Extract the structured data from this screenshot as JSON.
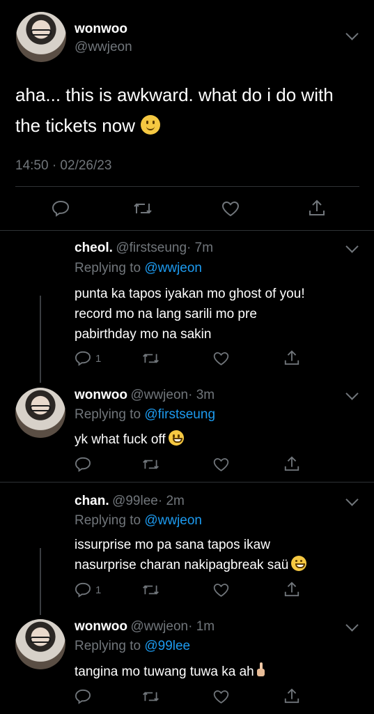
{
  "main_tweet": {
    "name": "wonwoo",
    "handle": "@wwjeon",
    "text": "aha... this is awkward. what do i do with the tickets now",
    "emoji": "slightly-smiling-face",
    "time": "14:50 · 02/26/23"
  },
  "replies": [
    {
      "name": "cheol.",
      "handle": "@firstseung",
      "age": "· 7m",
      "replying_label": "Replying to",
      "replying_to": "@wwjeon",
      "lines": [
        "punta ka tapos iyakan mo ghost of you!",
        "record mo na lang sarili mo pre",
        "pabirthday mo na sakin"
      ],
      "reply_count": "1"
    },
    {
      "name": "wonwoo",
      "handle": "@wwjeon",
      "age": "· 3m",
      "replying_label": "Replying to",
      "replying_to": "@firstseung",
      "lines": [
        "yk what fuck off"
      ],
      "emoji": "grinning-face",
      "reply_count": ""
    },
    {
      "name": "chan.",
      "handle": "@99lee",
      "age": "· 2m",
      "replying_label": "Replying to",
      "replying_to": "@wwjeon",
      "lines": [
        "issurprise mo pa sana tapos ikaw",
        "nasurprise charan nakipagbreak saü"
      ],
      "emoji": "laughing-squint-face",
      "reply_count": "1"
    },
    {
      "name": "wonwoo",
      "handle": "@wwjeon",
      "age": "· 1m",
      "replying_label": "Replying to",
      "replying_to": "@99lee",
      "lines": [
        "tangina mo tuwang tuwa ka ah"
      ],
      "emoji": "middle-finger",
      "reply_count": ""
    }
  ],
  "colors": {
    "background": "#000000",
    "text": "#ffffff",
    "muted": "#71767b",
    "link": "#1d9bf0",
    "divider": "#2f3336"
  }
}
